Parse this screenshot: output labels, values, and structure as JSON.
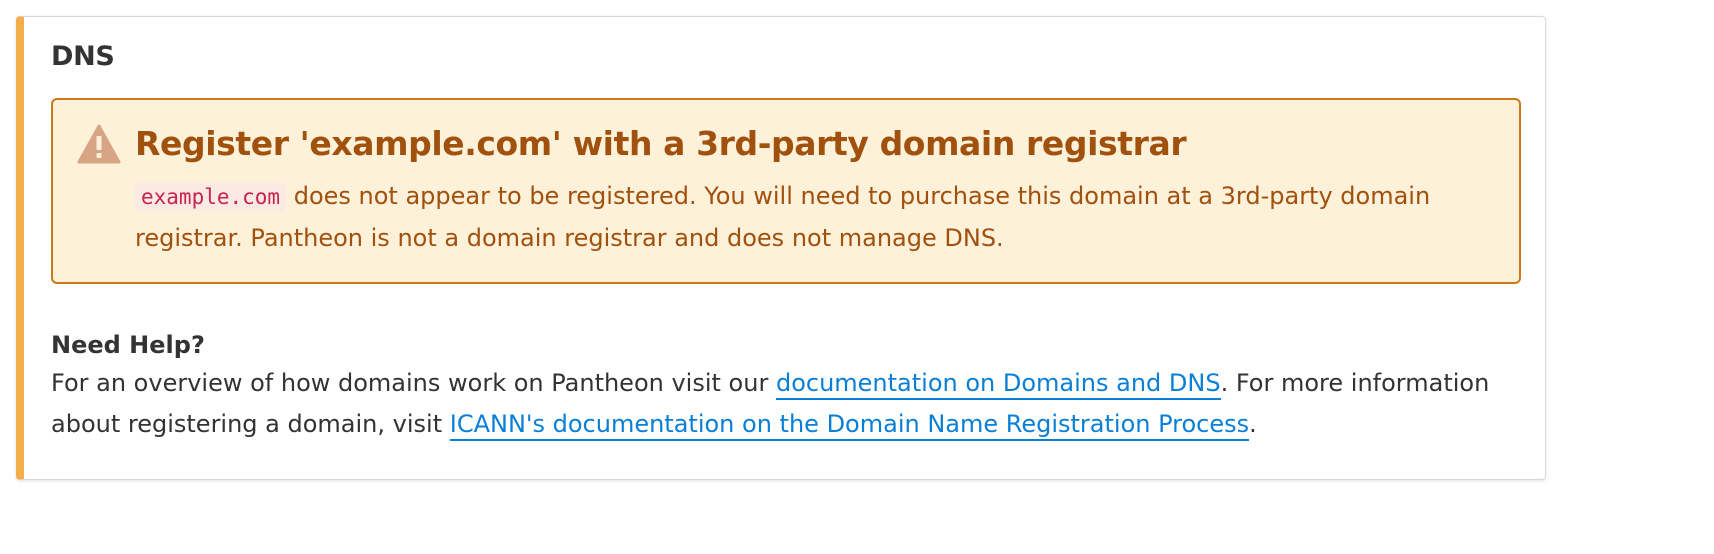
{
  "dns": {
    "title": "DNS"
  },
  "alert": {
    "icon": "warning-triangle-icon",
    "heading": "Register 'example.com' with a 3rd-party domain registrar",
    "domain_code": "example.com",
    "body": " does not appear to be registered. You will need to purchase this domain at a 3rd-party domain registrar. Pantheon is not a domain registrar and does not manage DNS.",
    "colors": {
      "background": "#fef1d9",
      "border": "#cc7a19",
      "text": "#a1510e"
    }
  },
  "help": {
    "title": "Need Help?",
    "text_1": "For an overview of how domains work on Pantheon visit our ",
    "link_1": "documentation on Domains and DNS",
    "text_2": ". For more information about registering a domain, visit ",
    "link_2": "ICANN's documentation on the Domain Name Registration Process",
    "text_3": "."
  },
  "accent_color": "#f4ad4b",
  "link_color": "#0a7fd6"
}
